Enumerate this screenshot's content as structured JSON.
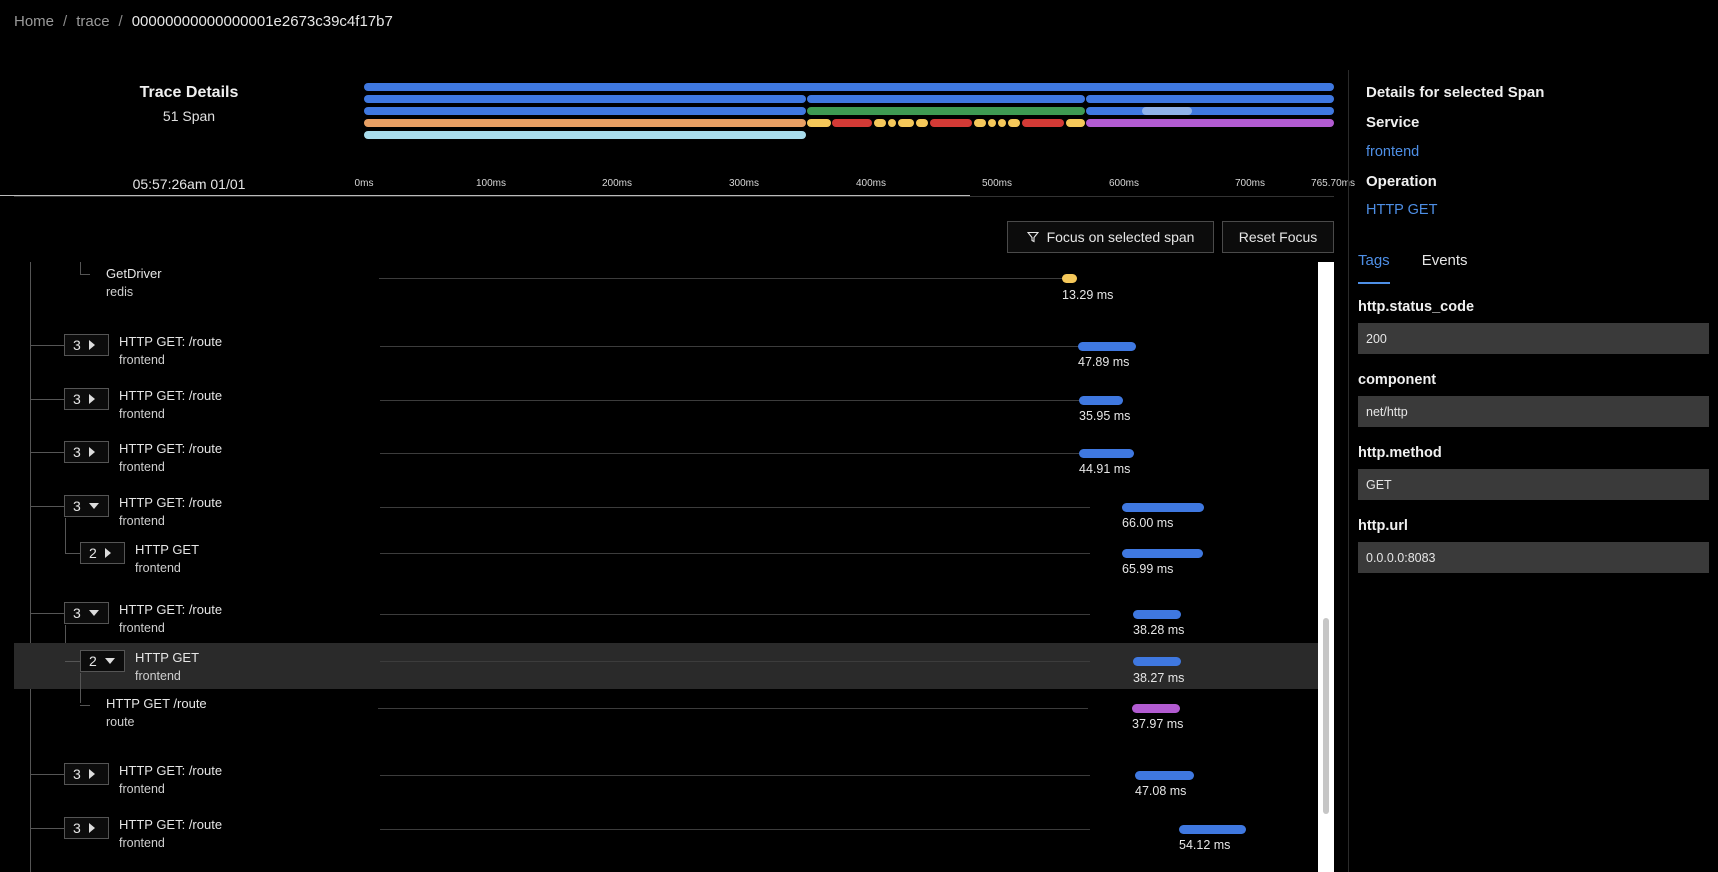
{
  "breadcrumb": {
    "home": "Home",
    "trace": "trace",
    "trace_id": "00000000000000001e2673c39c4f17b7",
    "separator": "/"
  },
  "header": {
    "title": "Trace Details",
    "span_count": "51 Span",
    "start_time": "05:57:26am 01/01"
  },
  "ruler": {
    "ticks": [
      "0ms",
      "100ms",
      "200ms",
      "300ms",
      "400ms",
      "500ms",
      "600ms",
      "700ms",
      "765.70ms"
    ]
  },
  "buttons": {
    "focus": "Focus on selected span",
    "reset": "Reset Focus"
  },
  "colors": {
    "frontend": "#3f78e0",
    "redis": "#f5c85a",
    "route": "#b25bd1",
    "customer": "#e8a064",
    "mysql": "#a8dcec",
    "driver": "#3e9a52",
    "redis_error": "#d33a36",
    "link": "#4e8fe6"
  },
  "spans": [
    {
      "name": "GetDriver",
      "service": "redis",
      "duration": "13.29 ms",
      "child_count": "",
      "expanded": false,
      "color": "#f5c85a"
    },
    {
      "name": "HTTP GET: /route",
      "service": "frontend",
      "duration": "47.89 ms",
      "child_count": "3",
      "expanded": false,
      "color": "#3f78e0"
    },
    {
      "name": "HTTP GET: /route",
      "service": "frontend",
      "duration": "35.95 ms",
      "child_count": "3",
      "expanded": false,
      "color": "#3f78e0"
    },
    {
      "name": "HTTP GET: /route",
      "service": "frontend",
      "duration": "44.91 ms",
      "child_count": "3",
      "expanded": false,
      "color": "#3f78e0"
    },
    {
      "name": "HTTP GET: /route",
      "service": "frontend",
      "duration": "66.00 ms",
      "child_count": "3",
      "expanded": true,
      "color": "#3f78e0"
    },
    {
      "name": "HTTP GET",
      "service": "frontend",
      "duration": "65.99 ms",
      "child_count": "2",
      "expanded": false,
      "color": "#3f78e0"
    },
    {
      "name": "HTTP GET: /route",
      "service": "frontend",
      "duration": "38.28 ms",
      "child_count": "3",
      "expanded": true,
      "color": "#3f78e0"
    },
    {
      "name": "HTTP GET",
      "service": "frontend",
      "duration": "38.27 ms",
      "child_count": "2",
      "expanded": true,
      "color": "#3f78e0",
      "selected": true
    },
    {
      "name": "HTTP GET /route",
      "service": "route",
      "duration": "37.97 ms",
      "child_count": "",
      "expanded": false,
      "color": "#b25bd1"
    },
    {
      "name": "HTTP GET: /route",
      "service": "frontend",
      "duration": "47.08 ms",
      "child_count": "3",
      "expanded": false,
      "color": "#3f78e0"
    },
    {
      "name": "HTTP GET: /route",
      "service": "frontend",
      "duration": "54.12 ms",
      "child_count": "3",
      "expanded": false,
      "color": "#3f78e0"
    }
  ],
  "details": {
    "title": "Details for selected Span",
    "service_label": "Service",
    "service_value": "frontend",
    "operation_label": "Operation",
    "operation_value": "HTTP GET",
    "tabs": [
      "Tags",
      "Events"
    ],
    "active_tab": "Tags",
    "tags": [
      {
        "key": "http.status_code",
        "value": "200"
      },
      {
        "key": "component",
        "value": "net/http"
      },
      {
        "key": "http.method",
        "value": "GET"
      },
      {
        "key": "http.url",
        "value": "0.0.0.0:8083"
      }
    ]
  }
}
